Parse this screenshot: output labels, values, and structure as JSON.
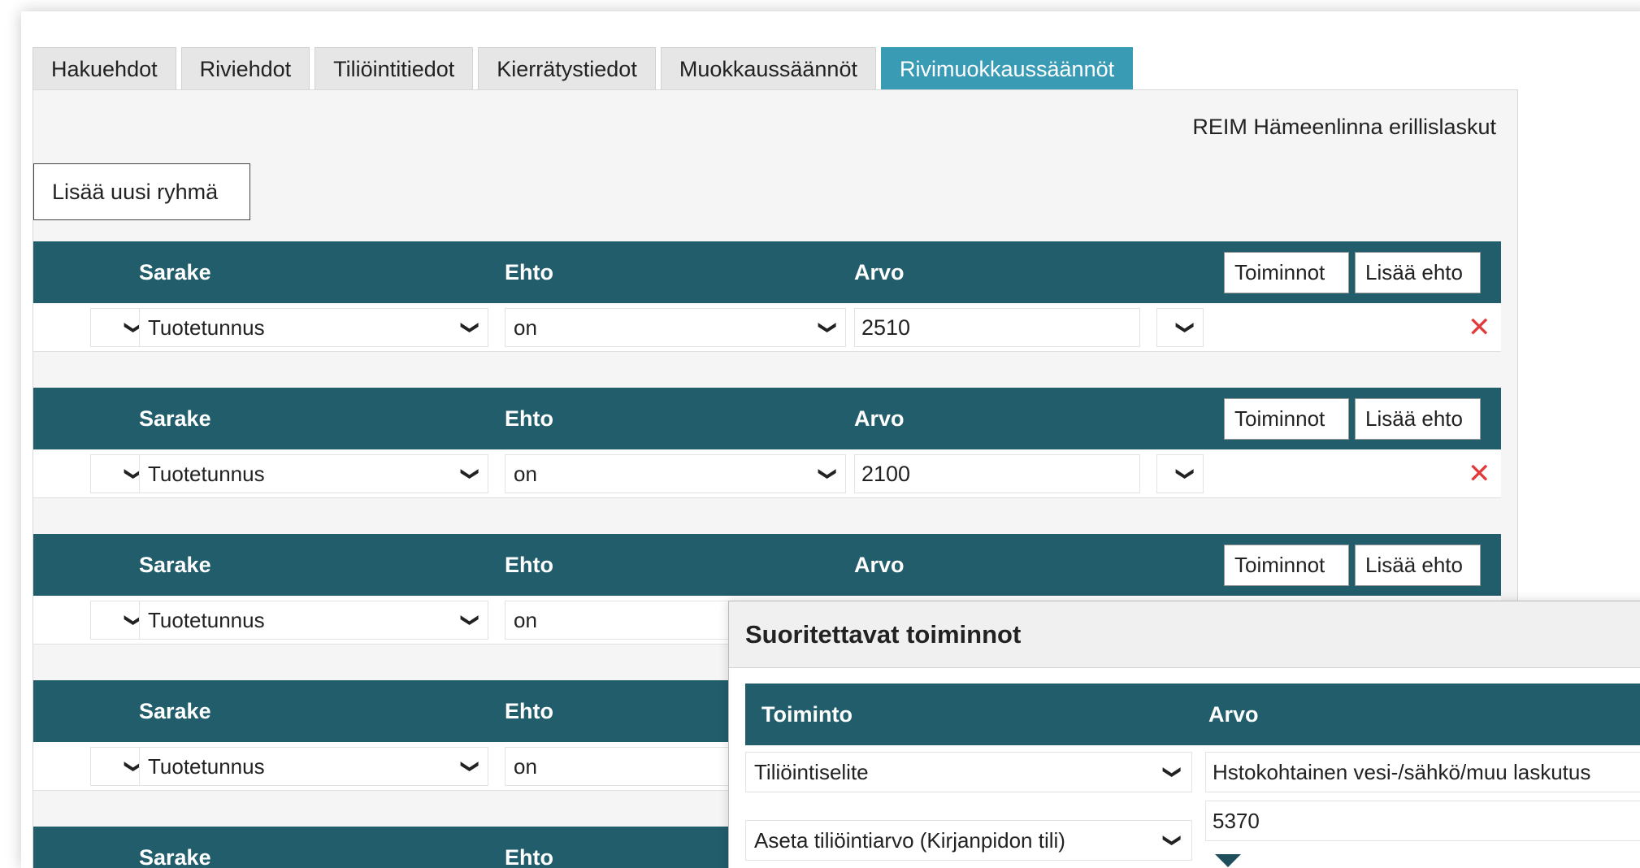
{
  "tabs": [
    "Hakuehdot",
    "Riviehdot",
    "Tiliöintitiedot",
    "Kierrätystiedot",
    "Muokkaussäännöt",
    "Rivimuokkaussäännöt"
  ],
  "active_tab": "Rivimuokkaussäännöt",
  "company_name": "REIM Hämeenlinna erillislaskut",
  "add_group_label": "Lisää uusi ryhmä",
  "group_header": {
    "sarake": "Sarake",
    "ehto": "Ehto",
    "arvo": "Arvo",
    "toiminnot_button": "Toiminnot",
    "lisaa_ehto_button": "Lisää ehto"
  },
  "groups": [
    {
      "sarake": "Tuotetunnus",
      "ehto": "on",
      "arvo": "2510"
    },
    {
      "sarake": "Tuotetunnus",
      "ehto": "on",
      "arvo": "2100"
    },
    {
      "sarake": "Tuotetunnus",
      "ehto": "on",
      "arvo": ""
    },
    {
      "sarake": "Tuotetunnus",
      "ehto": "on",
      "arvo": ""
    }
  ],
  "modal": {
    "title": "Suoritettavat toiminnot",
    "col_toiminto": "Toiminto",
    "col_arvo": "Arvo",
    "rows": [
      {
        "toiminto": "Tiliöintiselite",
        "arvo": "Hstokohtainen vesi-/sähkö/muu laskutus"
      },
      {
        "toiminto": "Aseta tiliöintiarvo (Kirjanpidon tili)",
        "arvo": "5370"
      }
    ]
  },
  "icons": {
    "chevron": "chevron-down-icon",
    "delete": "close-icon",
    "expand": "triangle-down-icon"
  },
  "colors": {
    "header_bg": "#225d6b",
    "active_tab": "#3a9bb5",
    "delete": "#e03a3a"
  }
}
